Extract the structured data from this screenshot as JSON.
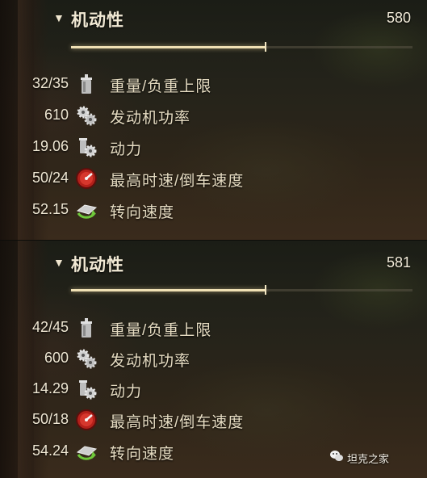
{
  "panels": [
    {
      "section_title": "机动性",
      "total": "580",
      "bar_fraction": 0.57,
      "stats": [
        {
          "value": "32/35",
          "label": "重量/负重上限",
          "icon": "weight-icon"
        },
        {
          "value": "610",
          "label": "发动机功率",
          "icon": "engine-gears-icon"
        },
        {
          "value": "19.06",
          "label": "动力",
          "icon": "power-ratio-icon"
        },
        {
          "value": "50/24",
          "label": "最高时速/倒车速度",
          "icon": "speedometer-icon"
        },
        {
          "value": "52.15",
          "label": "转向速度",
          "icon": "traverse-icon"
        }
      ]
    },
    {
      "section_title": "机动性",
      "total": "581",
      "bar_fraction": 0.57,
      "stats": [
        {
          "value": "42/45",
          "label": "重量/负重上限",
          "icon": "weight-icon"
        },
        {
          "value": "600",
          "label": "发动机功率",
          "icon": "engine-gears-icon"
        },
        {
          "value": "14.29",
          "label": "动力",
          "icon": "power-ratio-icon"
        },
        {
          "value": "50/18",
          "label": "最高时速/倒车速度",
          "icon": "speedometer-icon"
        },
        {
          "value": "54.24",
          "label": "转向速度",
          "icon": "traverse-icon"
        }
      ]
    }
  ],
  "watermark": {
    "text": "坦克之家",
    "icon": "wechat-icon"
  }
}
